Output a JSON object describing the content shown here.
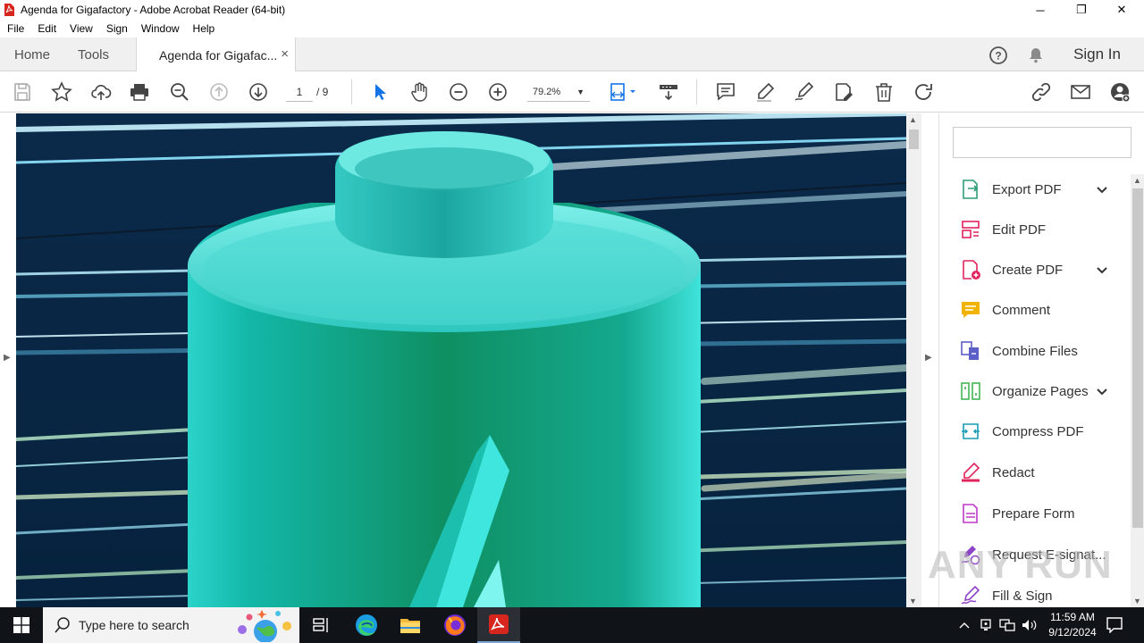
{
  "window": {
    "title": "Agenda for Gigafactory - Adobe Acrobat Reader (64-bit)",
    "controls": {
      "minimize": "─",
      "maximize": "❐",
      "close": "✕"
    }
  },
  "menu": [
    "File",
    "Edit",
    "View",
    "Sign",
    "Window",
    "Help"
  ],
  "tabs": {
    "home": "Home",
    "tools": "Tools",
    "document": "Agenda for Gigafac...",
    "close": "×"
  },
  "header": {
    "sign_in": "Sign In"
  },
  "toolbar": {
    "page_current": "1",
    "page_total": "/ 9",
    "zoom": "79.2%",
    "zoom_caret": "▼"
  },
  "right_pane": {
    "search_placeholder": "",
    "tools": [
      {
        "label": "Export PDF",
        "icon": "export-pdf-icon",
        "color": "#2d9d78",
        "expandable": true
      },
      {
        "label": "Edit PDF",
        "icon": "edit-pdf-icon",
        "color": "#e0245e",
        "expandable": false
      },
      {
        "label": "Create PDF",
        "icon": "create-pdf-icon",
        "color": "#e0245e",
        "expandable": true
      },
      {
        "label": "Comment",
        "icon": "comment-icon",
        "color": "#f0b400",
        "expandable": false
      },
      {
        "label": "Combine Files",
        "icon": "combine-files-icon",
        "color": "#5b5fc7",
        "expandable": false
      },
      {
        "label": "Organize Pages",
        "icon": "organize-pages-icon",
        "color": "#44b556",
        "expandable": true
      },
      {
        "label": "Compress PDF",
        "icon": "compress-pdf-icon",
        "color": "#1a9bb5",
        "expandable": false
      },
      {
        "label": "Redact",
        "icon": "redact-icon",
        "color": "#e0245e",
        "expandable": false
      },
      {
        "label": "Prepare Form",
        "icon": "prepare-form-icon",
        "color": "#c038cc",
        "expandable": false
      },
      {
        "label": "Request E-signat...",
        "icon": "request-esign-icon",
        "color": "#8e44c6",
        "expandable": false
      },
      {
        "label": "Fill & Sign",
        "icon": "fill-sign-icon",
        "color": "#8e44c6",
        "expandable": false
      }
    ]
  },
  "watermark": "ANY RUN",
  "taskbar": {
    "search_placeholder": "Type here to search",
    "time": "11:59 AM",
    "date": "9/12/2024"
  },
  "colors": {
    "accent": "#1473e6",
    "acrobat_red": "#d7261e",
    "taskbar": "#101418"
  }
}
